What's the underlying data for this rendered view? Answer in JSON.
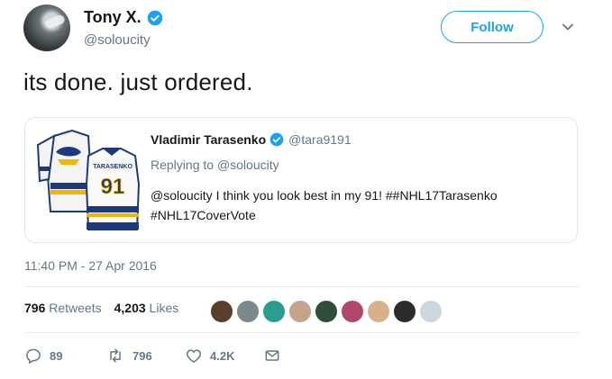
{
  "author": {
    "display_name": "Tony X.",
    "handle": "@soloucity",
    "verified": true
  },
  "follow_button": "Follow",
  "tweet_text": "its done. just ordered.",
  "quoted": {
    "display_name": "Vladimir Tarasenko",
    "handle": "@tara9191",
    "verified": true,
    "replying_prefix": "Replying to ",
    "replying_to": "@soloucity",
    "text_line1": "@soloucity I think you look best in my 91!  ##NHL17Tarasenko",
    "text_line2": "#NHL17CoverVote",
    "jersey_name": "TARASENKO",
    "jersey_number": "91"
  },
  "timestamp": "11:40 PM - 27 Apr 2016",
  "stats": {
    "retweets_count": "796",
    "retweets_label": "Retweets",
    "likes_count": "4,203",
    "likes_label": "Likes"
  },
  "liker_avatars": [
    {
      "name": "liker-avatar-1",
      "color": "#5a3d2b"
    },
    {
      "name": "liker-avatar-2",
      "color": "#7a8a8c"
    },
    {
      "name": "liker-avatar-3",
      "color": "#2a9d8f"
    },
    {
      "name": "liker-avatar-4",
      "color": "#c7a38a"
    },
    {
      "name": "liker-avatar-5",
      "color": "#2e4d3a"
    },
    {
      "name": "liker-avatar-6",
      "color": "#b3476b"
    },
    {
      "name": "liker-avatar-7",
      "color": "#d9b08c"
    },
    {
      "name": "liker-avatar-8",
      "color": "#2b2b2b"
    },
    {
      "name": "liker-avatar-9",
      "color": "#ccd6dd"
    }
  ],
  "actions": {
    "reply_count": "89",
    "retweet_count": "796",
    "like_count": "4.2K"
  },
  "colors": {
    "accent": "#1da1f2",
    "muted": "#657786",
    "border": "#e1e8ed"
  }
}
